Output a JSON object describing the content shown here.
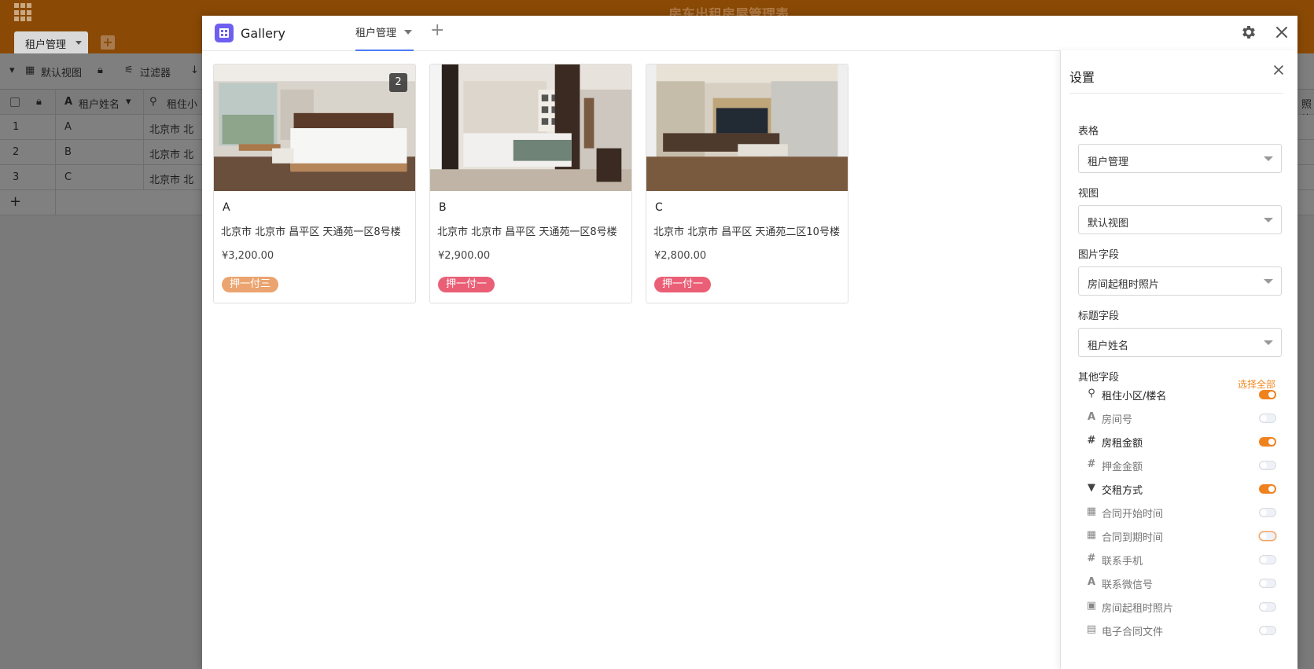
{
  "background": {
    "title": "房东出租房屋管理表",
    "tab_label": "租户管理",
    "toolbar": {
      "view": "默认视图",
      "filter": "过滤器"
    },
    "columns": {
      "name": "租户姓名",
      "addr": "租住小",
      "photo": "照片"
    },
    "rows": [
      {
        "num": "1",
        "name": "A",
        "addr": "北京市 北"
      },
      {
        "num": "2",
        "name": "B",
        "addr": "北京市 北"
      },
      {
        "num": "3",
        "name": "C",
        "addr": "北京市 北"
      }
    ],
    "add_row": "+"
  },
  "modal": {
    "app_name": "Gallery",
    "tab_label": "租户管理",
    "add_tab": "+"
  },
  "cards": [
    {
      "title": "A",
      "address": "北京市 北京市 昌平区 天通苑一区8号楼",
      "price": "¥3,200.00",
      "tag": "押一付三",
      "tag_color": "#eba46f",
      "image_count": "2"
    },
    {
      "title": "B",
      "address": "北京市 北京市 昌平区 天通苑一区8号楼",
      "price": "¥2,900.00",
      "tag": "押一付一",
      "tag_color": "#ea5f76"
    },
    {
      "title": "C",
      "address": "北京市 北京市 昌平区 天通苑二区10号楼",
      "price": "¥2,800.00",
      "tag": "押一付一",
      "tag_color": "#ea5f76"
    }
  ],
  "settings": {
    "title": "设置",
    "table_label": "表格",
    "table_value": "租户管理",
    "view_label": "视图",
    "view_value": "默认视图",
    "image_field_label": "图片字段",
    "image_field_value": "房间起租时照片",
    "title_field_label": "标题字段",
    "title_field_value": "租户姓名",
    "other_fields_label": "其他字段",
    "select_all": "选择全部",
    "fields": [
      {
        "label": "租住小区/楼名",
        "icon": "location-icon",
        "glyph": "⚲",
        "enabled": true
      },
      {
        "label": "房间号",
        "icon": "text-icon",
        "glyph": "A",
        "enabled": false
      },
      {
        "label": "房租金额",
        "icon": "number-icon",
        "glyph": "#",
        "enabled": true
      },
      {
        "label": "押金金额",
        "icon": "number-icon",
        "glyph": "#",
        "enabled": false
      },
      {
        "label": "交租方式",
        "icon": "single-select-icon",
        "glyph": "▼",
        "enabled": true
      },
      {
        "label": "合同开始时间",
        "icon": "calendar-icon",
        "glyph": "▦",
        "enabled": false
      },
      {
        "label": "合同到期时间",
        "icon": "calendar-icon",
        "glyph": "▦",
        "enabled": false,
        "focused": true
      },
      {
        "label": "联系手机",
        "icon": "number-icon",
        "glyph": "#",
        "enabled": false
      },
      {
        "label": "联系微信号",
        "icon": "text-icon",
        "glyph": "A",
        "enabled": false
      },
      {
        "label": "房间起租时照片",
        "icon": "image-icon",
        "glyph": "▣",
        "enabled": false
      },
      {
        "label": "电子合同文件",
        "icon": "file-icon",
        "glyph": "▤",
        "enabled": false
      }
    ]
  }
}
